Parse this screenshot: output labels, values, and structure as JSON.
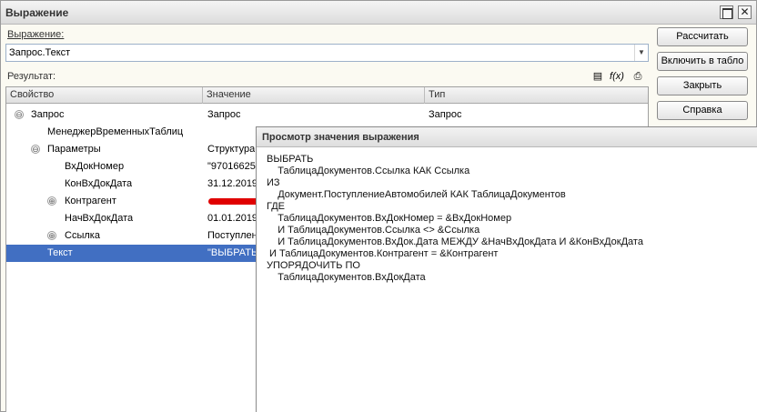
{
  "window": {
    "title": "Выражение"
  },
  "expression": {
    "label": "Выражение:",
    "value": "Запрос.Текст"
  },
  "result": {
    "label": "Результат:"
  },
  "buttons": {
    "calculate": "Рассчитать",
    "to_table": "Включить в табло",
    "close": "Закрыть",
    "help": "Справка"
  },
  "toolbar": {
    "fx_label": "f(x)"
  },
  "table": {
    "headers": [
      "Свойство",
      "Значение",
      "Тип"
    ],
    "rows": [
      {
        "property": "Запрос",
        "value": "Запрос",
        "type": "Запрос",
        "toggle": "⊖",
        "selected": false
      },
      {
        "property": "МенеджерВременныхТаблиц",
        "value": "",
        "type": "",
        "toggle": "",
        "selected": false
      },
      {
        "property": "Параметры",
        "value": "Структура",
        "type": "",
        "toggle": "⊖",
        "selected": false
      },
      {
        "property": "ВхДокНомер",
        "value": "\"97016625",
        "type": "",
        "toggle": "",
        "selected": false
      },
      {
        "property": "КонВхДокДата",
        "value": "31.12.2019",
        "type": "",
        "toggle": "",
        "selected": false
      },
      {
        "property": "Контрагент",
        "value": "",
        "type": "",
        "toggle": "⊕",
        "selected": false
      },
      {
        "property": "НачВхДокДата",
        "value": "01.01.2019",
        "type": "",
        "toggle": "",
        "selected": false
      },
      {
        "property": "Ссылка",
        "value": "Поступлен",
        "type": "",
        "toggle": "⊕",
        "selected": false
      },
      {
        "property": "Текст",
        "value": "\"ВЫБРАТЬ",
        "type": "",
        "toggle": "",
        "selected": true
      }
    ]
  },
  "popup": {
    "title": "Просмотр значения выражения",
    "lines": [
      "ВЫБРАТЬ",
      "    ТаблицаДокументов.Ссылка КАК Ссылка",
      "ИЗ",
      "    Документ.ПоступлениеАвтомобилей КАК ТаблицаДокументов",
      "ГДЕ",
      "    ТаблицаДокументов.ВхДокНомер = &ВхДокНомер",
      "    И ТаблицаДокументов.Ссылка <> &Ссылка",
      "    И ТаблицаДокументов.ВхДок.Дата МЕЖДУ &НачВхДокДата И &КонВхДокДата",
      " И ТаблицаДокументов.Контрагент = &Контрагент",
      "УПОРЯДОЧИТЬ ПО",
      "    ТаблицаДокументов.ВхДокДата"
    ]
  }
}
